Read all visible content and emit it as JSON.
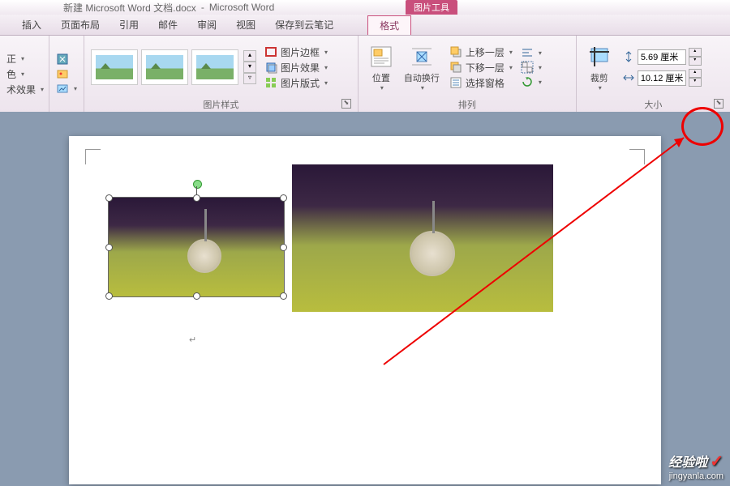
{
  "title_doc": "新建 Microsoft Word 文档.docx",
  "title_app": "Microsoft Word",
  "context_tool": "图片工具",
  "tabs": {
    "insert": "插入",
    "layout": "页面布局",
    "ref": "引用",
    "mail": "邮件",
    "review": "审阅",
    "view": "视图",
    "cloud": "保存到云笔记",
    "format": "格式"
  },
  "g1": {
    "correct": "正",
    "color": "色",
    "effects": "术效果"
  },
  "styles": {
    "label": "图片样式",
    "border": "图片边框",
    "effect": "图片效果",
    "layout": "图片版式"
  },
  "arrange": {
    "label": "排列",
    "position": "位置",
    "wrap": "自动换行",
    "up": "上移一层",
    "down": "下移一层",
    "pane": "选择窗格"
  },
  "size": {
    "label": "大小",
    "crop": "裁剪",
    "h": "5.69 厘米",
    "w": "10.12 厘米"
  },
  "wm": {
    "brand": "经验啦",
    "url": "jingyanla.com"
  }
}
